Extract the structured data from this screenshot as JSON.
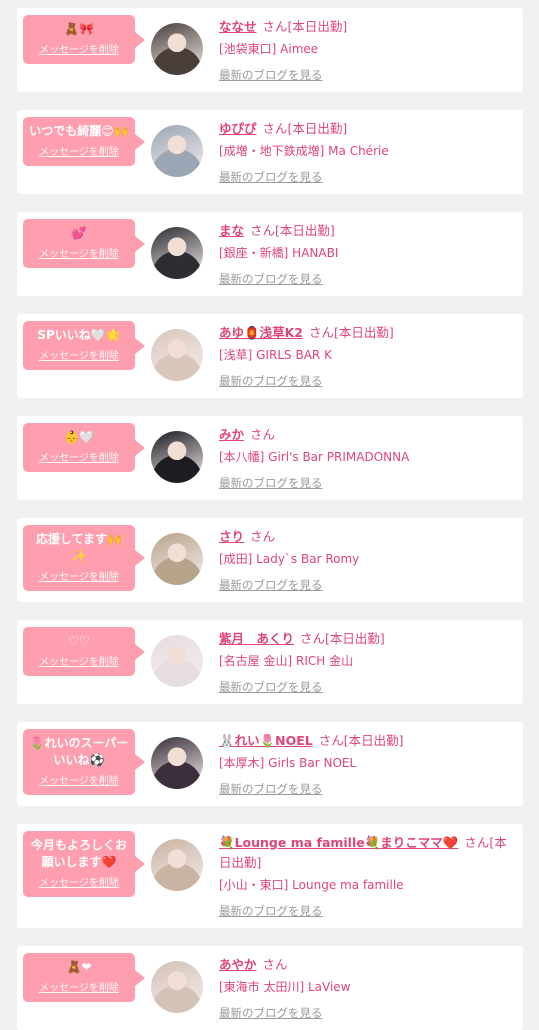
{
  "delete_label": "メッセージを削除",
  "blog_label": "最新のブログを見る",
  "san": "さん",
  "colors": {
    "bubble": "#ff9eae",
    "accent": "#e0457a",
    "muted": "#9a9a9a",
    "bg": "#f2f0f1"
  },
  "items": [
    {
      "message": "🧸🎀",
      "name": "ななせ",
      "status": "[本日出勤]",
      "shop": "[池袋東口] Aimee",
      "avatar_color": "#4a3e3a"
    },
    {
      "message": "いつでも綺麗😊🙌",
      "name": "ゆぴぴ",
      "status": "[本日出勤]",
      "shop": "[成増・地下鉄成増] Ma Chérie",
      "avatar_color": "#9aa6b4"
    },
    {
      "message": "💕",
      "name": "まな",
      "status": "[本日出勤]",
      "shop": "[銀座・新橋] HANABI",
      "avatar_color": "#2d2d34"
    },
    {
      "message": "SPいいね🤍🌟",
      "name": "あゆ🏮浅草K2",
      "status": "[本日出勤]",
      "shop": "[浅草] GIRLS BAR K",
      "avatar_color": "#d9c7bc"
    },
    {
      "message": "👶🤍",
      "name": "みか",
      "status": "",
      "shop": "[本八幡] Girl's Bar PRIMADONNA",
      "avatar_color": "#1e1c22"
    },
    {
      "message": "応援してます🙌✨",
      "name": "さり",
      "status": "",
      "shop": "[成田] Lady`s Bar Romy",
      "avatar_color": "#b7a58b"
    },
    {
      "message": "♡♡",
      "name": "紫月　あくり",
      "status": "[本日出勤]",
      "shop": "[名古屋 金山] RICH 金山",
      "avatar_color": "#e6dde0"
    },
    {
      "message": "🌷れいのスーパーいいね⚽",
      "name": "🐰れい🌷NOEL",
      "status": "[本日出勤]",
      "shop": "[本厚木] Girls Bar NOEL",
      "avatar_color": "#3a2f3a"
    },
    {
      "message": "今月もよろしくお願いします❤️",
      "name": "💐Lounge ma famille💐まりこママ❤️",
      "status": "[本日出勤]",
      "shop": "[小山・東口] Lounge ma famille",
      "avatar_color": "#c9b3a2"
    },
    {
      "message": "🧸❤",
      "name": "あやか",
      "status": "",
      "shop": "[東海市 太田川] LaView",
      "avatar_color": "#d3c2b6"
    }
  ]
}
